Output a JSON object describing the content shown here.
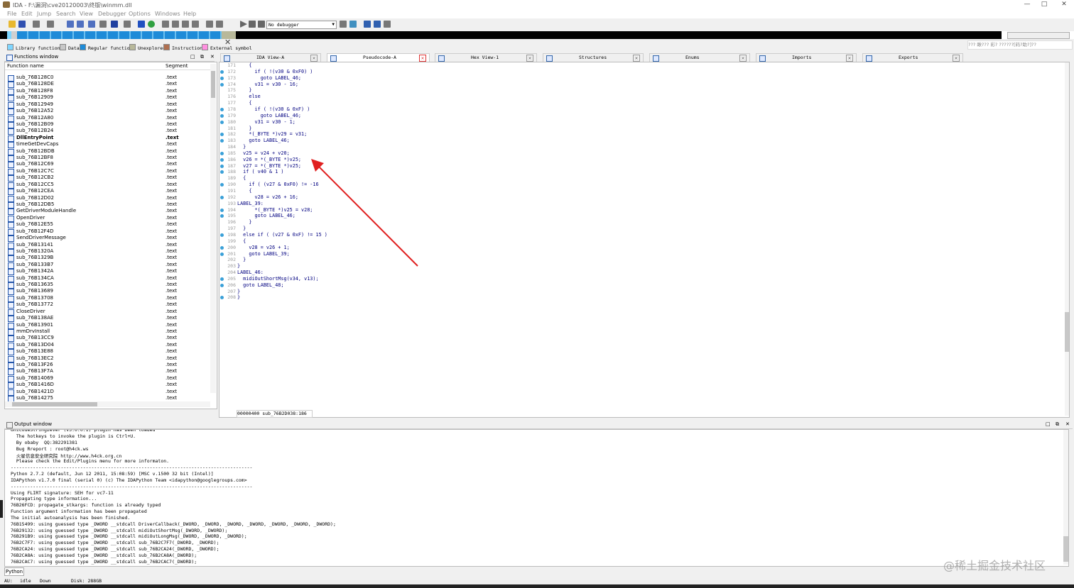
{
  "window": {
    "title": "IDA - F:\\漏洞\\cve20120003\\终版\\winmm.dll",
    "minimize": "—",
    "maximize": "□",
    "close": "✕"
  },
  "menu": [
    "File",
    "Edit",
    "Jump",
    "Search",
    "View",
    "Debugger",
    "Options",
    "Windows",
    "Help"
  ],
  "toolbar": {
    "debugger": "No debugger"
  },
  "top_right_text": "??? 瞅???  彩? ??????[码?助?]??",
  "legend": [
    "Library function",
    "Data",
    "Regular function",
    "Unexplored",
    "Instruction",
    "External symbol"
  ],
  "legend_colors": [
    "#7fd6ff",
    "#c8c8c8",
    "#1e8bd8",
    "#b8b89a",
    "#b07050",
    "#ff90e0"
  ],
  "functions_window": {
    "title": "Functions window",
    "col_name": "Function name",
    "col_segment": "Segment",
    "rows": [
      [
        "sub_76B128C0",
        ".text"
      ],
      [
        "sub_76B128DE",
        ".text"
      ],
      [
        "sub_76B128F8",
        ".text"
      ],
      [
        "sub_76B12909",
        ".text"
      ],
      [
        "sub_76B12949",
        ".text"
      ],
      [
        "sub_76B12A52",
        ".text"
      ],
      [
        "sub_76B12A80",
        ".text"
      ],
      [
        "sub_76B12B09",
        ".text"
      ],
      [
        "sub_76B12B24",
        ".text"
      ],
      [
        "DllEntryPoint",
        ".text"
      ],
      [
        "timeGetDevCaps",
        ".text"
      ],
      [
        "sub_76B12BDB",
        ".text"
      ],
      [
        "sub_76B12BF8",
        ".text"
      ],
      [
        "sub_76B12C69",
        ".text"
      ],
      [
        "sub_76B12C7C",
        ".text"
      ],
      [
        "sub_76B12CB2",
        ".text"
      ],
      [
        "sub_76B12CC5",
        ".text"
      ],
      [
        "sub_76B12CEA",
        ".text"
      ],
      [
        "sub_76B12D02",
        ".text"
      ],
      [
        "sub_76B12DB5",
        ".text"
      ],
      [
        "GetDriverModuleHandle",
        ".text"
      ],
      [
        "OpenDriver",
        ".text"
      ],
      [
        "sub_76B12E55",
        ".text"
      ],
      [
        "sub_76B12F4D",
        ".text"
      ],
      [
        "SendDriverMessage",
        ".text"
      ],
      [
        "sub_76B13141",
        ".text"
      ],
      [
        "sub_76B1320A",
        ".text"
      ],
      [
        "sub_76B1329B",
        ".text"
      ],
      [
        "sub_76B133B7",
        ".text"
      ],
      [
        "sub_76B1342A",
        ".text"
      ],
      [
        "sub_76B134CA",
        ".text"
      ],
      [
        "sub_76B13635",
        ".text"
      ],
      [
        "sub_76B13689",
        ".text"
      ],
      [
        "sub_76B13708",
        ".text"
      ],
      [
        "sub_76B13772",
        ".text"
      ],
      [
        "CloseDriver",
        ".text"
      ],
      [
        "sub_76B138AE",
        ".text"
      ],
      [
        "sub_76B13901",
        ".text"
      ],
      [
        "mmDrvInstall",
        ".text"
      ],
      [
        "sub_76B13CC9",
        ".text"
      ],
      [
        "sub_76B13D04",
        ".text"
      ],
      [
        "sub_76B13E88",
        ".text"
      ],
      [
        "sub_76B13EC2",
        ".text"
      ],
      [
        "sub_76B13F26",
        ".text"
      ],
      [
        "sub_76B13F7A",
        ".text"
      ],
      [
        "sub_76B14069",
        ".text"
      ],
      [
        "sub_76B1416D",
        ".text"
      ],
      [
        "sub_76B1421D",
        ".text"
      ],
      [
        "sub_76B14275",
        ".text"
      ]
    ]
  },
  "tabs": [
    "IDA View-A",
    "Pseudocode-A",
    "Hex View-1",
    "Structures",
    "Enums",
    "Imports",
    "Exports"
  ],
  "code": [
    [
      "171",
      "    {"
    ],
    [
      "172",
      "      if ( !(v30 & 0xF0) )"
    ],
    [
      "173",
      "        goto LABEL_46;"
    ],
    [
      "174",
      "      v31 = v30 - 16;"
    ],
    [
      "175",
      "    }"
    ],
    [
      "176",
      "    else"
    ],
    [
      "177",
      "    {"
    ],
    [
      "178",
      "      if ( !(v30 & 0xF) )"
    ],
    [
      "179",
      "        goto LABEL_46;"
    ],
    [
      "180",
      "      v31 = v30 - 1;"
    ],
    [
      "181",
      "    }"
    ],
    [
      "182",
      "    *(_BYTE *)v29 = v31;"
    ],
    [
      "183",
      "    goto LABEL_46;"
    ],
    [
      "184",
      "  }"
    ],
    [
      "185",
      "  v25 = v24 + v20;"
    ],
    [
      "186",
      "  v26 = *(_BYTE *)v25;"
    ],
    [
      "187",
      "  v27 = *(_BYTE *)v25;"
    ],
    [
      "188",
      "  if ( v40 & 1 )"
    ],
    [
      "189",
      "  {"
    ],
    [
      "190",
      "    if ( (v27 & 0xF0) != -16"
    ],
    [
      "191",
      "    {"
    ],
    [
      "192",
      "      v28 = v26 + 16;"
    ],
    [
      "193",
      "LABEL_39:"
    ],
    [
      "194",
      "      *(_BYTE *)v25 = v28;"
    ],
    [
      "195",
      "      goto LABEL_46;"
    ],
    [
      "196",
      "    }"
    ],
    [
      "197",
      "  }"
    ],
    [
      "198",
      "  else if ( (v27 & 0xF) != 15 )"
    ],
    [
      "199",
      "  {"
    ],
    [
      "200",
      "    v28 = v26 + 1;"
    ],
    [
      "201",
      "    goto LABEL_39;"
    ],
    [
      "202",
      "  }"
    ],
    [
      "203",
      "}"
    ],
    [
      "204",
      "LABEL_46:"
    ],
    [
      "205",
      "  midiOutShortMsg(v34, v13);"
    ],
    [
      "206",
      "  goto LABEL_48;"
    ],
    [
      "207",
      "}"
    ],
    [
      "208",
      "}"
    ]
  ],
  "code_status": "00000400 sub_76B2D038:186",
  "output": {
    "title": "Output window",
    "lines": [
      "UnicodeString2ever (v3.0.0.1) plugin has been loaded",
      "  The hotkeys to invoke the plugin is Ctrl+U.",
      "  By obaby  QQ:382291381",
      "  Bug Rreport : root@h4ck.ws",
      "  火星信息安全研究院 http://www.h4ck.org.cn",
      "  Please check the Edit/Plugins menu for more informaton.",
      "---------------------------------------------------------------------------------------",
      "Python 2.7.2 (default, Jun 12 2011, 15:08:59) [MSC v.1500 32 bit (Intel)]",
      "IDAPython v1.7.0 final (serial 0) (c) The IDAPython Team <idapython@googlegroups.com>",
      "---------------------------------------------------------------------------------------",
      "Using FLIRT signature: SEH for vc7-11",
      "Propagating type information...",
      "76B26FCD: propagate_stkargs: function is already typed",
      "Function argument information has been propagated",
      "The initial autoanalysis has been finished.",
      "76B15499: using guessed type _DWORD __stdcall DriverCallback(_DWORD, _DWORD, _DWORD, _DWORD, _DWORD, _DWORD, _DWORD);",
      "76B29132: using guessed type _DWORD __stdcall midiOutShortMsg(_DWORD, _DWORD);",
      "76B291B9: using guessed type _DWORD __stdcall midiOutLongMsg(_DWORD, _DWORD, _DWORD);",
      "76B2C7F7: using guessed type _DWORD __stdcall sub_76B2C7F7(_DWORD, _DWORD);",
      "76B2CA24: using guessed type _DWORD __stdcall sub_76B2CA24(_DWORD, _DWORD);",
      "76B2CA8A: using guessed type _DWORD __stdcall sub_76B2CA8A(_DWORD);",
      "76B2CAC7: using guessed type _DWORD __stdcall sub_76B2CAC7(_DWORD);"
    ],
    "python_tab": "Python"
  },
  "status": {
    "au": "AU:",
    "state": "idle",
    "dir": "Down",
    "disk": "Disk: 288GB"
  },
  "watermark": "@稀土掘金技术社区"
}
